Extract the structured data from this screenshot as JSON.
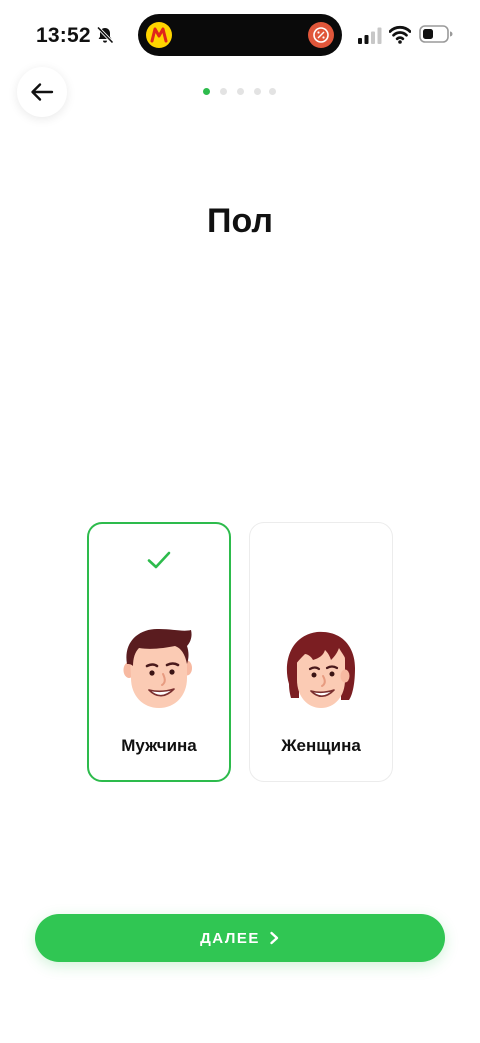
{
  "status_bar": {
    "time": "13:52",
    "icons": [
      "bell-off-icon",
      "cellular-signal-icon",
      "wifi-icon",
      "battery-icon"
    ]
  },
  "header": {
    "back_icon": "arrow-left-icon",
    "pager": {
      "total": 5,
      "current": 1
    }
  },
  "main": {
    "title": "Пол",
    "options": [
      {
        "id": "male",
        "label": "Мужчина",
        "selected": true,
        "icon": "male-avatar-icon"
      },
      {
        "id": "female",
        "label": "Женщина",
        "selected": false,
        "icon": "female-avatar-icon"
      }
    ]
  },
  "footer": {
    "next_label": "ДАЛЕЕ",
    "next_icon": "chevron-right-icon"
  },
  "colors": {
    "accent": "#30c653",
    "selected_border": "#2dbb4c",
    "pager_inactive": "#e3e3e3",
    "text": "#111111"
  }
}
